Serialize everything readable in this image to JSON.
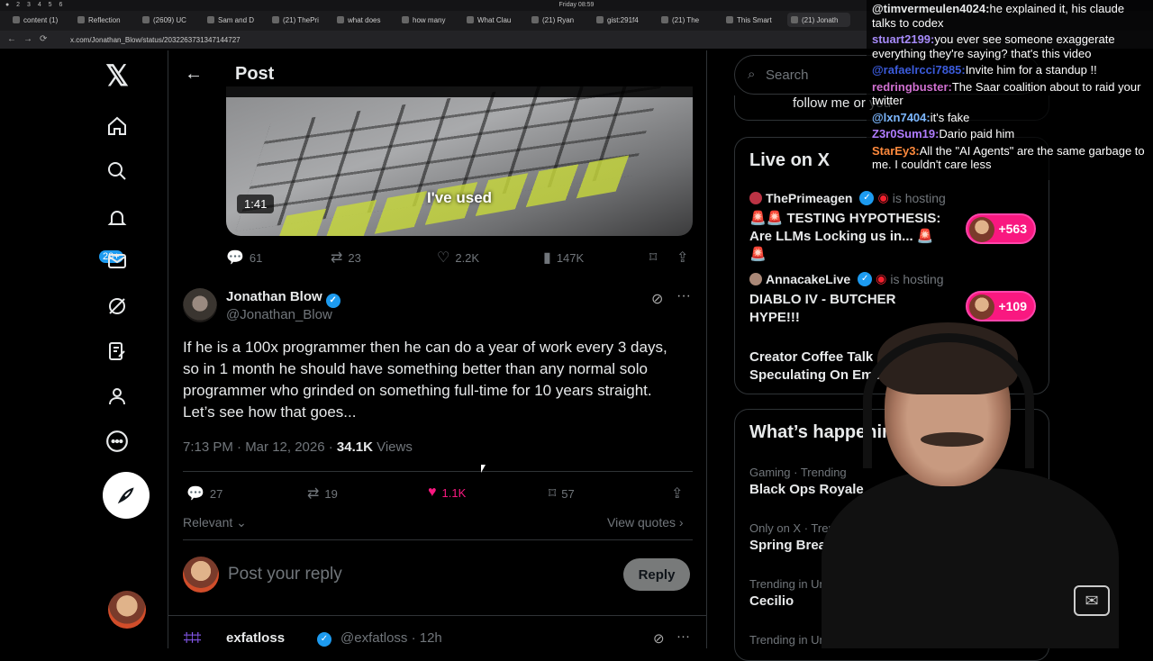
{
  "browser": {
    "clock": "Friday 08:59",
    "tabs": [
      "content (1)",
      "Reflection",
      "(2609) UC",
      "Sam and D",
      "(21) ThePri",
      "what does",
      "how many",
      "What Clau",
      "(21) Ryan",
      "gist:291f4",
      "(21) The",
      "This Smart",
      "(21) Jonath"
    ],
    "url": "x.com/Jonathan_Blow/status/2032263731347144727"
  },
  "nav": {
    "notifications_badge": "20+"
  },
  "header": {
    "title": "Post"
  },
  "video": {
    "duration": "1:41",
    "caption": "I've used"
  },
  "video_actions": {
    "replies": "61",
    "reposts": "23",
    "likes": "2.2K",
    "views": "147K"
  },
  "tweet": {
    "author_name": "Jonathan Blow",
    "author_handle": "@Jonathan_Blow",
    "text": "If he is a 100x programmer then he can do a year of work every 3 days, so in 1 month he should have something better than any normal solo programmer who grinded on something full-time for 10 years straight. Let’s see how that goes...",
    "time": "7:13 PM · Mar 12, 2026 · ",
    "views_count": "34.1K",
    "views_label": " Views",
    "replies": "27",
    "reposts": "19",
    "likes": "1.1K",
    "bookmarks": "57"
  },
  "sort": {
    "relevant": "Relevant",
    "view_quotes": "View quotes"
  },
  "reply_box": {
    "placeholder": "Post your reply",
    "button": "Reply"
  },
  "next_reply": {
    "name": "exfatloss",
    "handle": "@exfatloss · 12h"
  },
  "sidebar": {
    "search_placeholder": "Search",
    "follow_fragment": "follow me or you",
    "live_title": "Live on X",
    "live": [
      {
        "host": "ThePrimeagen",
        "status": "is hosting",
        "title": "🚨🚨 TESTING HYPOTHESIS: Are LLMs Locking us in... 🚨🚨",
        "count": "+563"
      },
      {
        "host": "AnnacakeLive",
        "status": "is hosting",
        "title": "DIABLO IV - BUTCHER HYPE!!!",
        "count": "+109"
      },
      {
        "host": "",
        "status": "",
        "title": "Creator Coffee Talk ☕🎙 Speculating On Emergin...",
        "count": ""
      }
    ],
    "happening_title": "What’s happening",
    "trends": [
      {
        "category": "Gaming · Trending",
        "title": "Black Ops Royale"
      },
      {
        "category": "Only on X · Trending",
        "title": "Spring Break"
      },
      {
        "category": "Trending in United States",
        "title": "Cecilio"
      },
      {
        "category": "Trending in United States",
        "title": ""
      }
    ]
  },
  "chat": [
    {
      "user": "@timvermeulen4024:",
      "msg": "he explained it, his claude talks to codex",
      "color": "#e7e9ea"
    },
    {
      "user": "stuart2199:",
      "msg": "you ever see someone exaggerate everything they're saying? that's this video",
      "color": "#a78bfa"
    },
    {
      "user": "@rafaelrcci7885:",
      "msg": "Invite him for a standup !!",
      "color": "#3b5bdb"
    },
    {
      "user": "redringbuster:",
      "msg": "The Saar coalition about to raid your twitter",
      "color": "#d070d0"
    },
    {
      "user": "@lxn7404:",
      "msg": "it's fake",
      "color": "#7cb7ff"
    },
    {
      "user": "Z3r0Sum19:",
      "msg": "Dario paid him",
      "color": "#b07cff"
    },
    {
      "user": "StarEy3:",
      "msg": "All the \"AI Agents\" are the same garbage to me. I couldn't care less",
      "color": "#ff8a3d"
    }
  ]
}
